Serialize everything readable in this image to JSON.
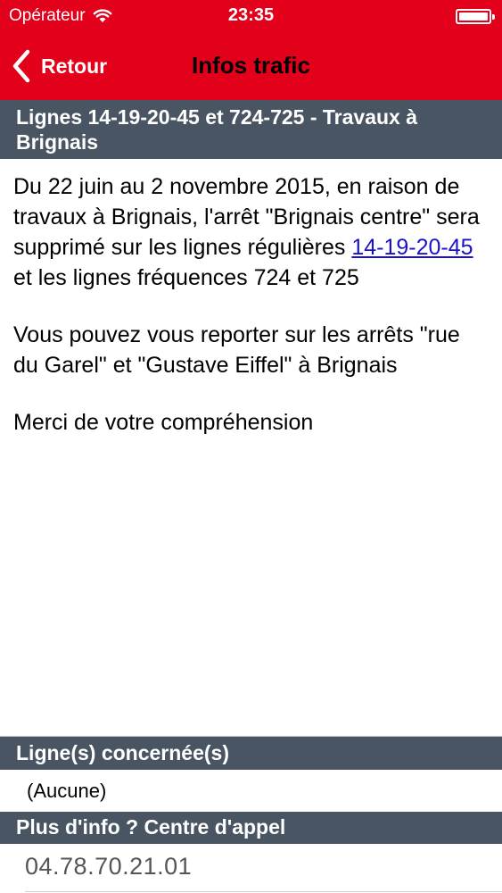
{
  "status_bar": {
    "carrier": "Opérateur",
    "time": "23:35"
  },
  "nav": {
    "back_label": "Retour",
    "title": "Infos trafic"
  },
  "article": {
    "title": "Lignes 14-19-20-45 et 724-725 - Travaux à Brignais",
    "p1_before_link": "Du 22 juin au 2 novembre 2015, en raison de travaux à Brignais, l'arrêt \"Brignais centre\" sera supprimé sur les lignes régulières",
    "p1_link": "14-19-20-45",
    "p1_after_link": "et les lignes fréquences 724 et 725",
    "p2": "Vous pouvez vous reporter sur les arrêts \"rue du Garel\" et \"Gustave Eiffel\" à Brignais",
    "p3": "Merci de votre compréhension"
  },
  "lines_section": {
    "header": "Ligne(s) concernée(s)",
    "value": "(Aucune)"
  },
  "info_section": {
    "header": "Plus d'info ? Centre d'appel",
    "phone": "04.78.70.21.01"
  },
  "colors": {
    "navbar": "#e3001b",
    "section_header": "#4a5563",
    "link": "#1a12c9"
  },
  "icons": [
    "wifi-icon",
    "battery-icon",
    "chevron-left-icon"
  ]
}
